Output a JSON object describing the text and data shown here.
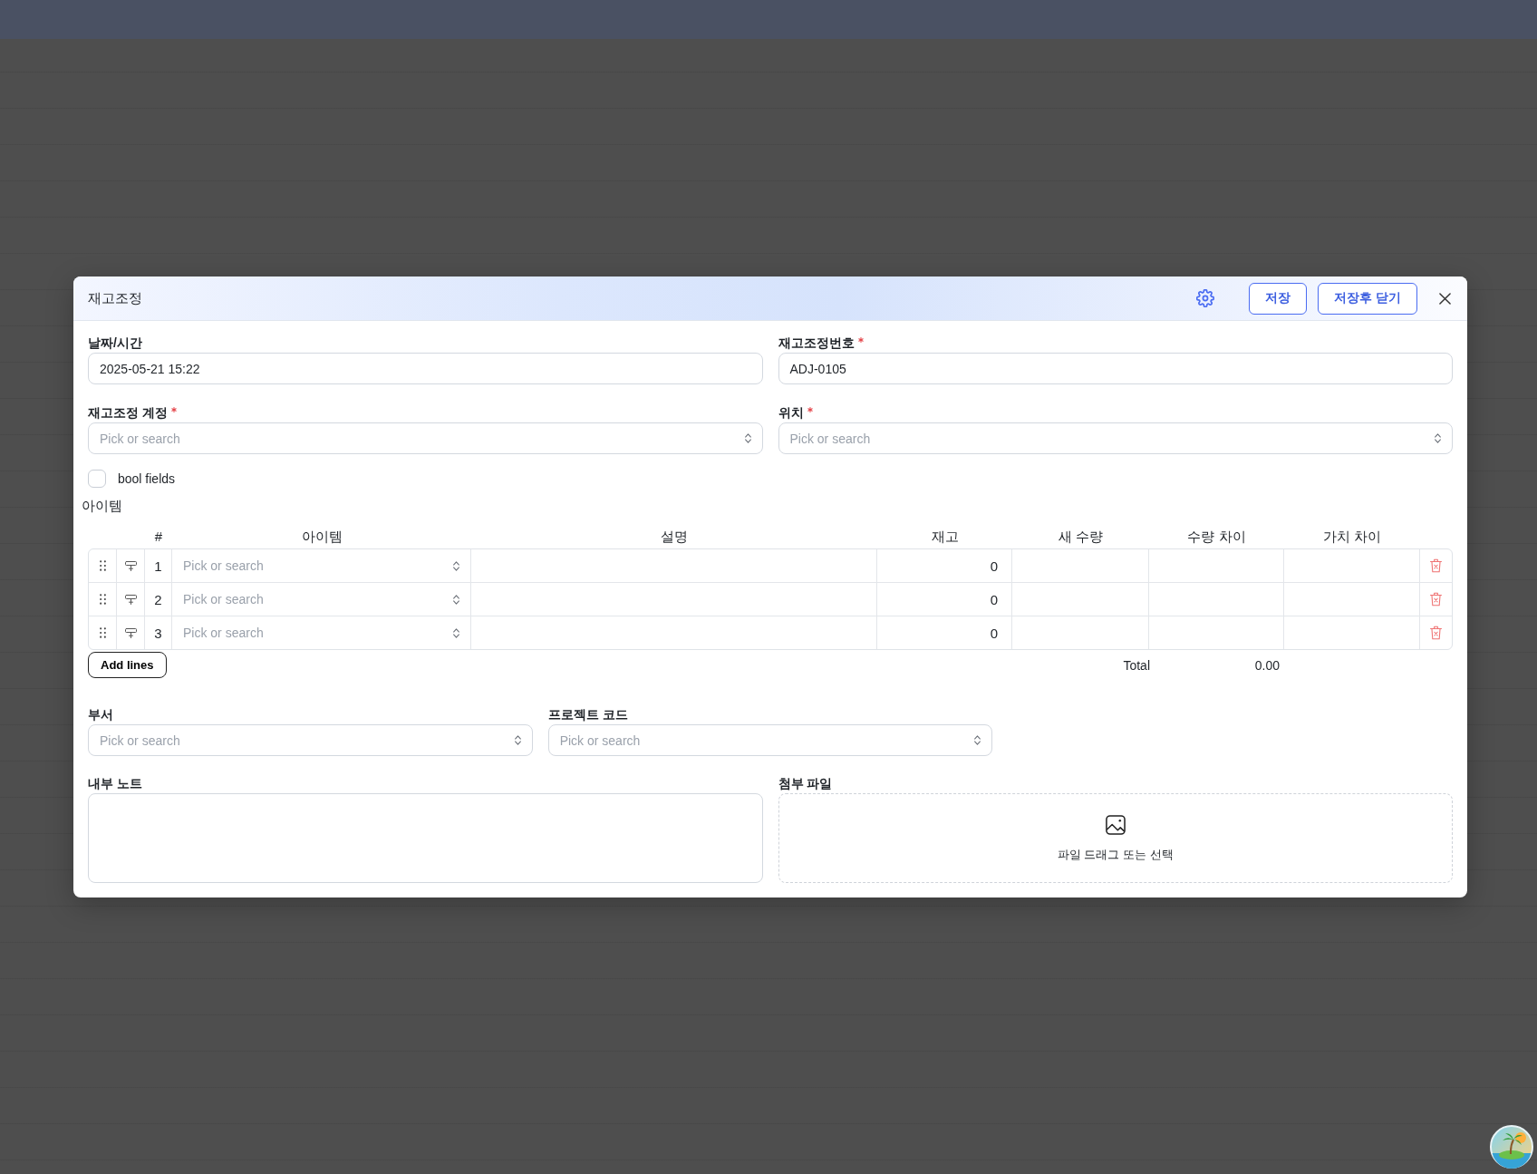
{
  "dialog": {
    "title": "재고조정",
    "buttons": [
      {
        "label": "저장"
      },
      {
        "label": "저장후 닫기"
      }
    ]
  },
  "form": {
    "fields": [
      {
        "label": "날짜/시간",
        "required": false,
        "kind": "text",
        "value": "2025-05-21 15:22"
      },
      {
        "label": "재고조정번호",
        "required": true,
        "kind": "text",
        "value": "ADJ-0105"
      },
      {
        "label": "재고조정 계정",
        "required": true,
        "kind": "select",
        "placeholder": "Pick or search"
      },
      {
        "label": "위치",
        "required": true,
        "kind": "select",
        "placeholder": "Pick or search"
      }
    ],
    "checkbox": {
      "label": "bool fields",
      "checked": false
    }
  },
  "items": {
    "title": "아이템",
    "columns": [
      "#",
      "아이템",
      "설명",
      "재고",
      "새 수량",
      "수량 차이",
      "가치 차이"
    ],
    "rows": [
      {
        "number": "1",
        "item": {
          "placeholder": "Pick or search"
        },
        "stock": "0"
      },
      {
        "number": "2",
        "item": {
          "placeholder": "Pick or search"
        },
        "stock": "0"
      },
      {
        "number": "3",
        "item": {
          "placeholder": "Pick or search"
        },
        "stock": "0"
      }
    ],
    "add_button": "Add lines",
    "total": {
      "label": "Total",
      "value": "0.00"
    }
  },
  "extra_fields": [
    {
      "label": "부서",
      "required": false,
      "kind": "select",
      "placeholder": "Pick or search"
    },
    {
      "label": "프로젝트 코드",
      "required": false,
      "kind": "select",
      "placeholder": "Pick or search"
    }
  ],
  "notes": {
    "label": "내부 노트"
  },
  "attachments": {
    "label": "첨부 파일",
    "hint": "파일 드래그 또는 선택"
  }
}
